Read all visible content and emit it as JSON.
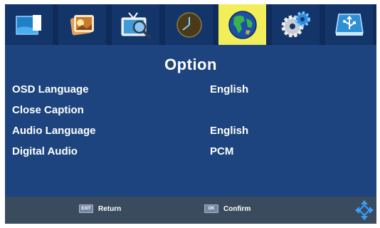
{
  "tabs": [
    {
      "icon": "picture-icon"
    },
    {
      "icon": "photo-icon"
    },
    {
      "icon": "tv-search-icon"
    },
    {
      "icon": "clock-icon"
    },
    {
      "icon": "globe-icon",
      "active": true
    },
    {
      "icon": "gear-icon"
    },
    {
      "icon": "usb-icon"
    }
  ],
  "page": {
    "title": "Option"
  },
  "options": [
    {
      "label": "OSD Language",
      "value": "English"
    },
    {
      "label": "Close Caption",
      "value": ""
    },
    {
      "label": "Audio Language",
      "value": "English"
    },
    {
      "label": "Digital Audio",
      "value": "PCM"
    }
  ],
  "footer": {
    "return_key": "EXIT",
    "return_label": "Return",
    "confirm_key": "OK",
    "confirm_label": "Confirm"
  },
  "colors": {
    "panel": "#1d447e",
    "tab_bar": "#0f2b5b",
    "active_tab": "#f1ee5a",
    "footer": "#3b4b5e"
  }
}
